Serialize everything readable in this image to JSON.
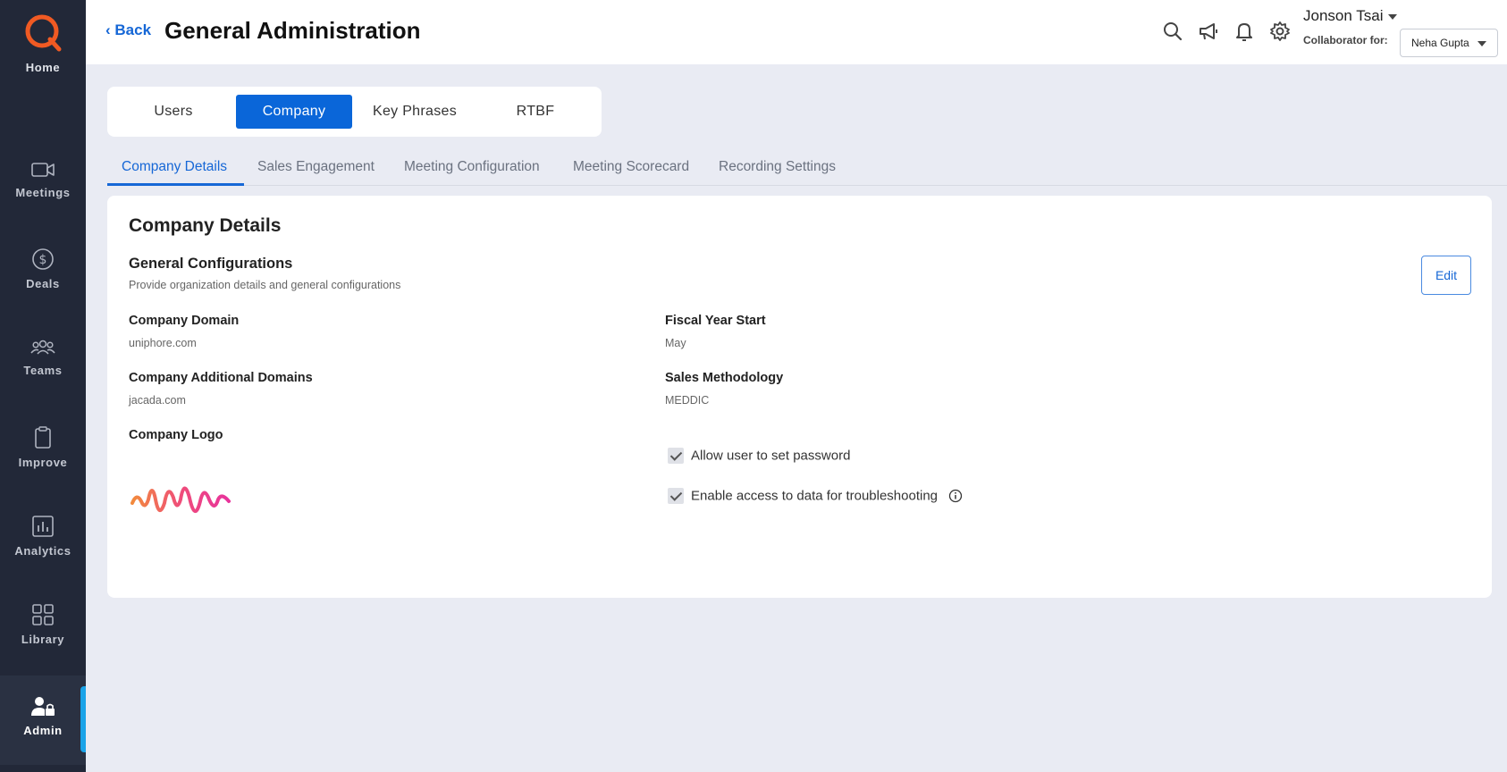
{
  "sidebar": {
    "home_label": "Home",
    "items": [
      {
        "label": "Meetings",
        "icon": "video-camera-icon"
      },
      {
        "label": "Deals",
        "icon": "dollar-circle-icon"
      },
      {
        "label": "Teams",
        "icon": "people-group-icon"
      },
      {
        "label": "Improve",
        "icon": "clipboard-icon"
      },
      {
        "label": "Analytics",
        "icon": "bar-chart-icon"
      },
      {
        "label": "Library",
        "icon": "grid-icon"
      },
      {
        "label": "Admin",
        "icon": "user-lock-icon",
        "active": true
      }
    ],
    "colors": {
      "background": "#222838",
      "active_bar": "#1aa3e8",
      "logo": "#f05a23"
    }
  },
  "header": {
    "back_label": "Back",
    "title": "General Administration",
    "icons": [
      "search-icon",
      "megaphone-icon",
      "bell-icon",
      "gear-icon"
    ],
    "user_name": "Jonson Tsai",
    "collaborator_label": "Collaborator for:",
    "collaborator_value": "Neha Gupta"
  },
  "tabs": [
    {
      "label": "Users"
    },
    {
      "label": "Company",
      "active": true
    },
    {
      "label": "Key Phrases"
    },
    {
      "label": "RTBF"
    }
  ],
  "subtabs": [
    {
      "label": "Company Details",
      "active": true
    },
    {
      "label": "Sales Engagement"
    },
    {
      "label": "Meeting Configuration"
    },
    {
      "label": "Meeting Scorecard"
    },
    {
      "label": "Recording Settings"
    }
  ],
  "card": {
    "title": "Company Details",
    "section_title": "General Configurations",
    "section_subtitle": "Provide organization details and general configurations",
    "edit_label": "Edit",
    "fields": {
      "company_domain": {
        "label": "Company Domain",
        "value": "uniphore.com"
      },
      "fiscal_year_start": {
        "label": "Fiscal Year Start",
        "value": "May"
      },
      "additional_domains": {
        "label": "Company Additional Domains",
        "value": "jacada.com"
      },
      "sales_methodology": {
        "label": "Sales Methodology",
        "value": "MEDDIC"
      },
      "company_logo": {
        "label": "Company Logo"
      }
    },
    "checkboxes": [
      {
        "label": "Allow user to set password",
        "checked": true
      },
      {
        "label": "Enable access to data for troubleshooting",
        "checked": true,
        "info": true
      }
    ]
  },
  "colors": {
    "accent": "#0a66d9",
    "page_background": "#e9ebf3"
  }
}
